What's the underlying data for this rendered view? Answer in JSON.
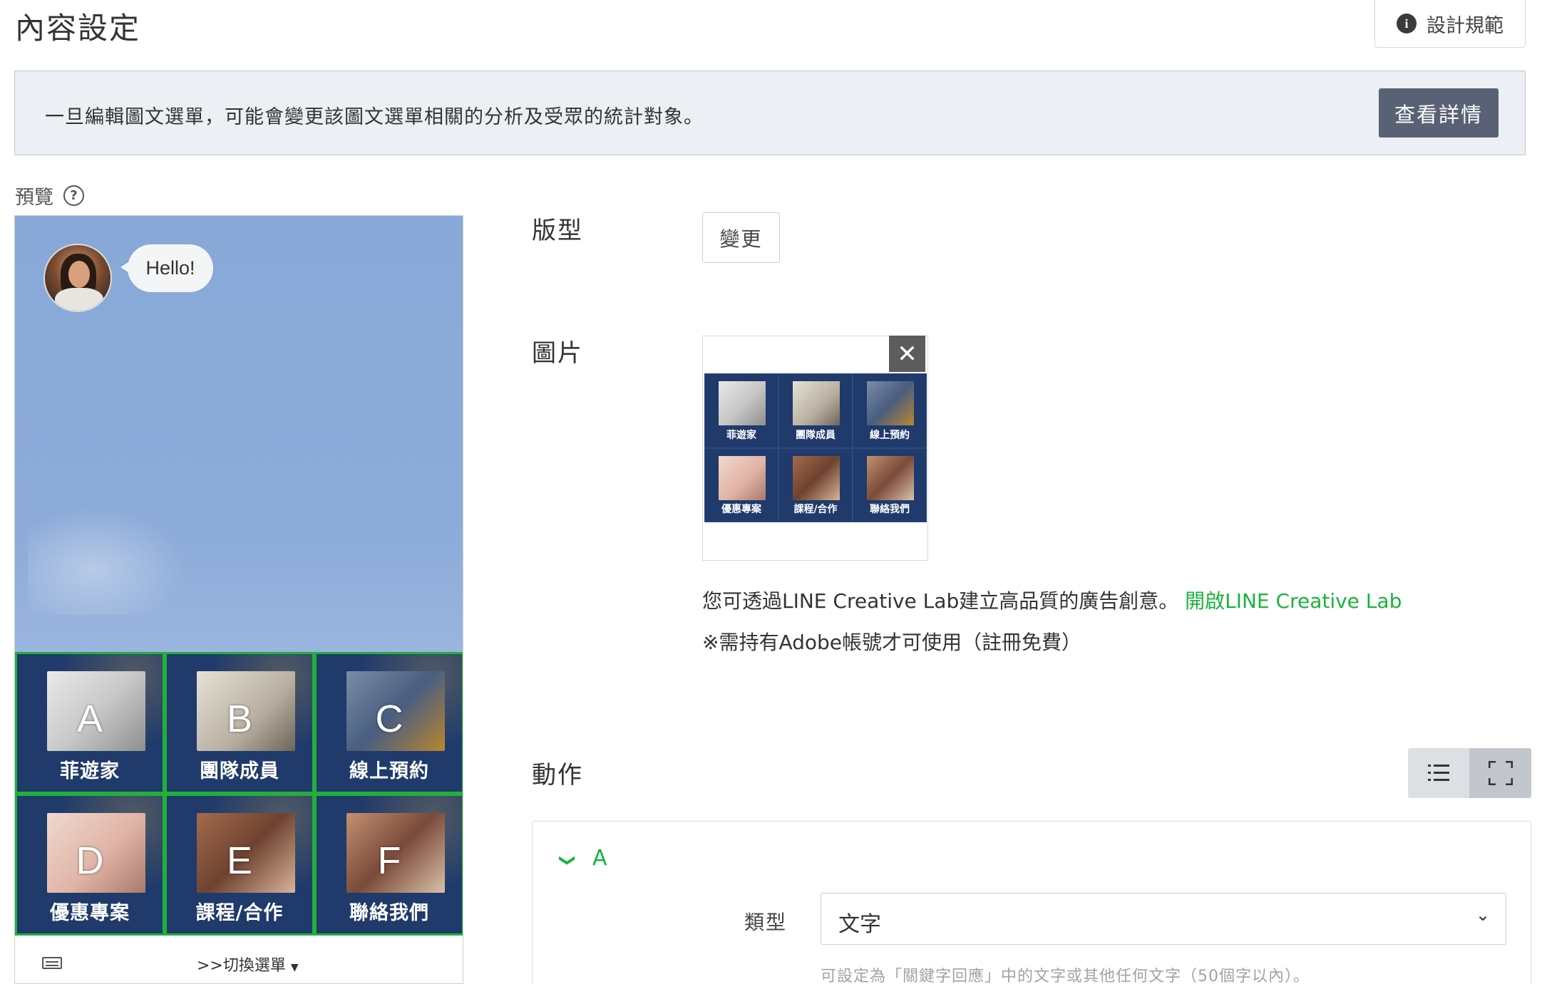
{
  "header": {
    "title": "內容設定",
    "design_button_label": "設計規範"
  },
  "notice": {
    "text": "一旦編輯圖文選單，可能會變更該圖文選單相關的分析及受眾的統計對象。",
    "button_label": "查看詳情"
  },
  "preview": {
    "label": "預覽",
    "chat_bubble": "Hello!",
    "menu_cells": [
      {
        "letter": "A",
        "label": "菲遊家"
      },
      {
        "letter": "B",
        "label": "團隊成員"
      },
      {
        "letter": "C",
        "label": "線上預約"
      },
      {
        "letter": "D",
        "label": "優惠專案"
      },
      {
        "letter": "E",
        "label": "課程/合作"
      },
      {
        "letter": "F",
        "label": "聯絡我們"
      }
    ],
    "switch_menu_label": ">>切換選單"
  },
  "layout_section": {
    "label": "版型",
    "change_button": "變更"
  },
  "image_section": {
    "label": "圖片",
    "thumbnail_cells": [
      "菲遊家",
      "團隊成員",
      "線上預約",
      "優惠專案",
      "課程/合作",
      "聯絡我們"
    ],
    "hint_text": "您可透過LINE Creative Lab建立高品質的廣告創意。",
    "hint_link": "開啟LINE Creative Lab",
    "note": "※需持有Adobe帳號才可使用（註冊免費）"
  },
  "action_section": {
    "label": "動作",
    "current_area": "A",
    "type_label": "類型",
    "type_value": "文字",
    "type_hint": "可設定為「關鍵字回應」中的文字或其他任何文字（50個字以內）。"
  },
  "colors": {
    "accent_green": "#19b33c",
    "notice_button": "#596275",
    "chat_background": "#88a9d8",
    "menu_background": "#1f3a6b"
  },
  "icons": [
    "info-icon",
    "help-icon",
    "keyboard-icon",
    "caret-down-icon",
    "close-icon",
    "list-view-icon",
    "fullscreen-icon",
    "chevron-down-icon"
  ]
}
